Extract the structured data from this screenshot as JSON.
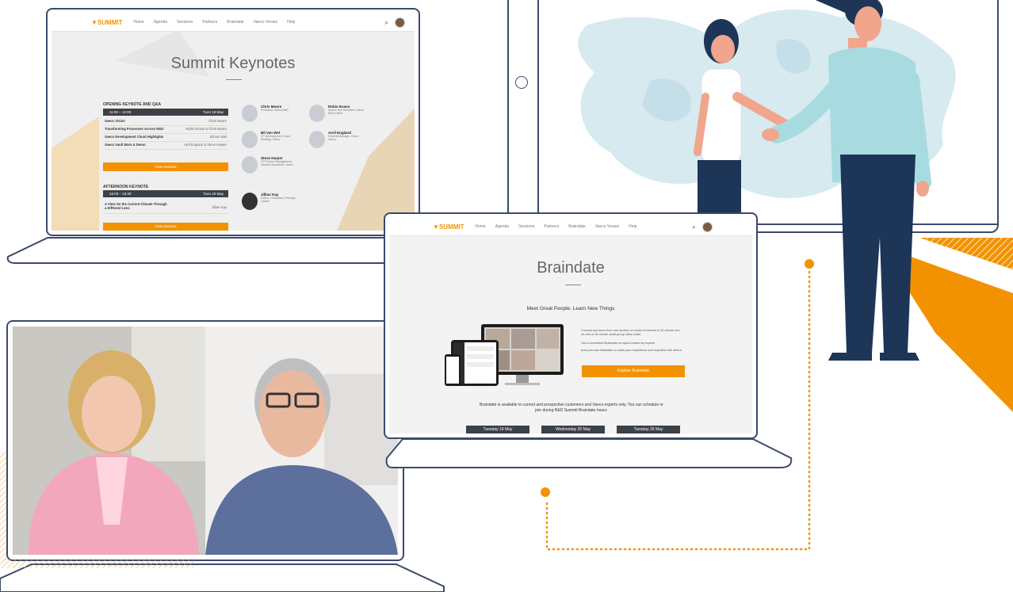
{
  "summit_keynotes": {
    "nav": {
      "logo": "▼SUMMIT",
      "items": [
        "Home",
        "Agenda",
        "Sessions",
        "Partners",
        "Braindate",
        "Vaeco Verses",
        "Help"
      ]
    },
    "page_title": "Summit Keynotes",
    "opening": {
      "label": "OPENING KEYNOTE AND Q&A",
      "time": "11:00 – 12:00",
      "date": "Tues 19 May",
      "rows": [
        {
          "title": "Vaeco Vision",
          "speaker": "Chris Moore"
        },
        {
          "title": "Transforming Processes Across R&D",
          "speaker": "Robin Evans & Chris Moore"
        },
        {
          "title": "Vaeco Development Cloud Highlights",
          "speaker": "Bil van Wel"
        },
        {
          "title": "Vaeco Vault Wars & Demo",
          "speaker": "Avril England & Steve Harper"
        }
      ],
      "button": "View Session"
    },
    "afternoon": {
      "label": "AFTERNOON KEYNOTE",
      "time": "16:00 – 16:30",
      "date": "Tues 19 May",
      "rows": [
        {
          "title": "A View On the Current Climate Through a Different Lens",
          "speaker": "Jillian Kay"
        }
      ],
      "button": "View Session"
    },
    "speakers": [
      {
        "name": "Chris Moore",
        "role": "President, Vaeco R&D"
      },
      {
        "name": "Robin Evans",
        "role": "Senior Vice President, Vaeco R&D EMEA"
      },
      {
        "name": "Bil Van Wel",
        "role": "VP Development, Cloud Strategy, Vaeco"
      },
      {
        "name": "Avril England",
        "role": "General Manager, Cloud Vaeco"
      },
      {
        "name": "Steve Harper",
        "role": "VP Product Management, Clinical Operations, Vaeco"
      },
      {
        "name": "Jillian Kay",
        "role": "Author, Consultant, Perhaps Leader"
      }
    ]
  },
  "braindate": {
    "nav": {
      "logo": "▼SUMMIT",
      "items": [
        "Home",
        "Agenda",
        "Sessions",
        "Partners",
        "Braindate",
        "Vaeco Verses",
        "Help"
      ]
    },
    "page_title": "Braindate",
    "subtitle": "Meet Great People, Learn New Things",
    "description": "Connect and learn from one another on topics of interest in 30-minute one-on-one or 45-minute small group video chats.",
    "bullets": [
      "Join a scheduled Braindate on topics hosted by experts",
      "Add your own Braindate to share your experience and expertise with others"
    ],
    "cta": "Explore Braindate",
    "availability": "Braindate is available to current and prospective customers and Vaeco experts only. You can schedule or join during R&D Summit Braindate hours.",
    "days": [
      "Tuesday 19 May",
      "Wednesday 20 May",
      "Tuesday 26 May"
    ]
  },
  "colors": {
    "accent": "#f39200",
    "frame": "#3b4a6b",
    "dark_bar": "#3c4148",
    "map": "#d6eaf0"
  }
}
